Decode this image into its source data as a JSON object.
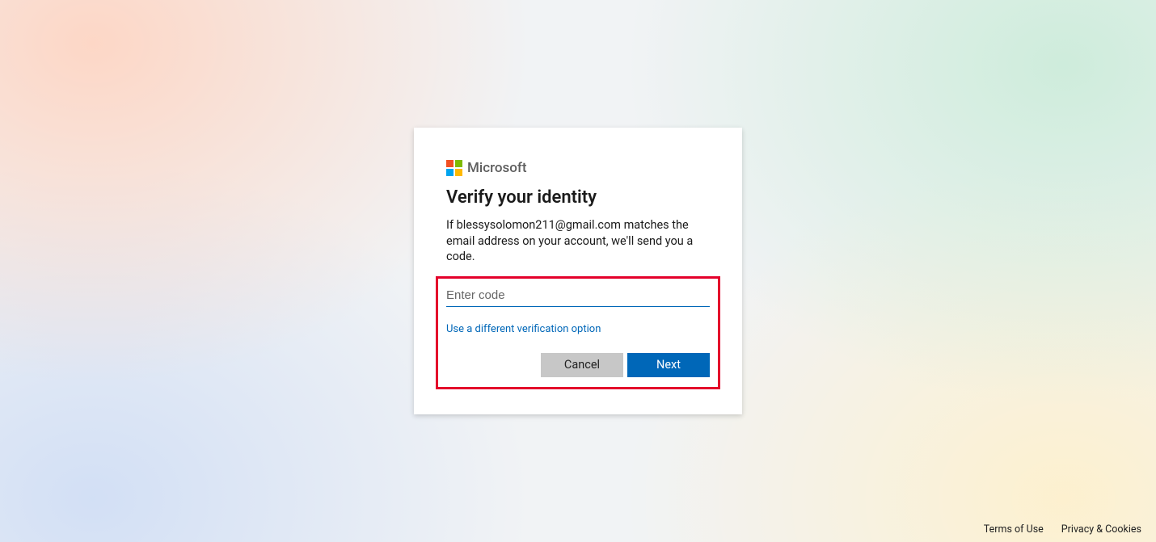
{
  "brand": {
    "name": "Microsoft"
  },
  "dialog": {
    "title": "Verify your identity",
    "description": "If blessysolomon211@gmail.com matches the email address on your account, we'll send you a code.",
    "code_placeholder": "Enter code",
    "code_value": "",
    "alt_link": "Use a different verification option",
    "cancel_label": "Cancel",
    "next_label": "Next"
  },
  "footer": {
    "terms": "Terms of Use",
    "privacy": "Privacy & Cookies"
  }
}
